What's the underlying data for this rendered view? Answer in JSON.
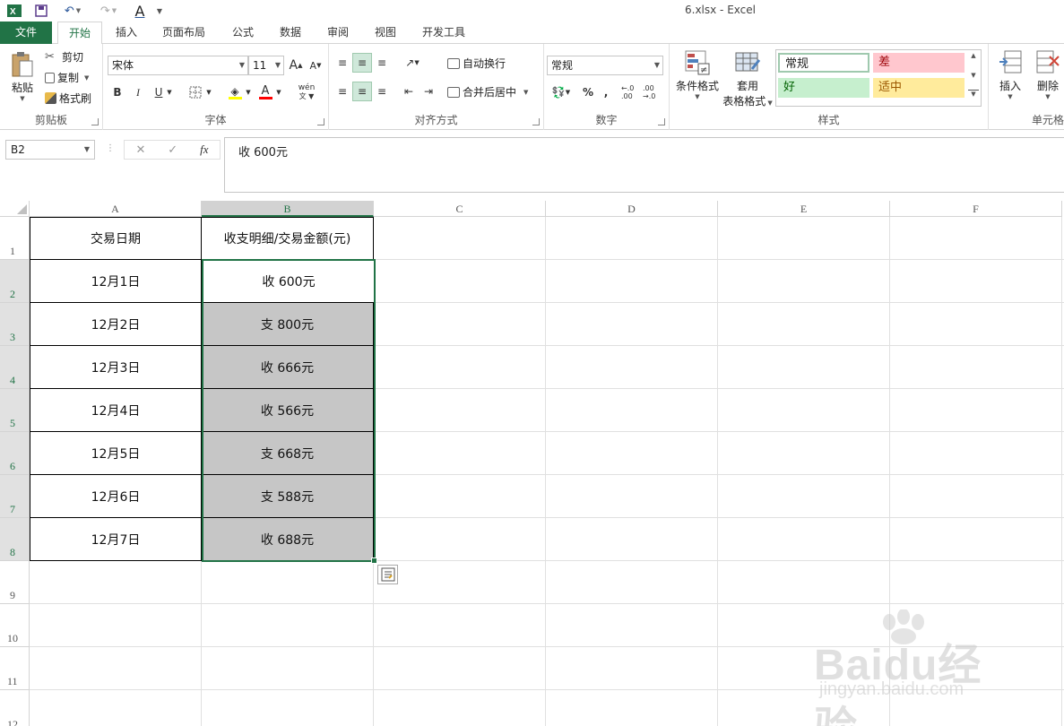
{
  "window": {
    "title": "6.xlsx - Excel"
  },
  "ribbon_tabs": [
    {
      "label": "文件"
    },
    {
      "label": "开始"
    },
    {
      "label": "插入"
    },
    {
      "label": "页面布局"
    },
    {
      "label": "公式"
    },
    {
      "label": "数据"
    },
    {
      "label": "审阅"
    },
    {
      "label": "视图"
    },
    {
      "label": "开发工具"
    }
  ],
  "clipboard": {
    "paste": "粘贴",
    "cut": "剪切",
    "copy": "复制",
    "format_painter": "格式刷",
    "group": "剪贴板"
  },
  "font": {
    "name": "宋体",
    "size": "11",
    "group": "字体",
    "bold": "B",
    "italic": "I",
    "underline": "U",
    "grow": "A",
    "shrink": "A",
    "phonetic": "wén",
    "font_color_letter": "A"
  },
  "alignment": {
    "wrap": "自动换行",
    "merge": "合并后居中",
    "group": "对齐方式"
  },
  "number": {
    "format": "常规",
    "group": "数字",
    "percent": "%",
    "comma": ",",
    "inc_dec": "←.0 .00",
    "dec_dec": ".00 →.0"
  },
  "styles": {
    "conditional": "条件格式",
    "table_1": "套用",
    "table_2": "表格格式",
    "group": "样式",
    "cells": [
      {
        "label": "常规",
        "bg": "#ffffff",
        "fg": "#000000"
      },
      {
        "label": "差",
        "bg": "#ffc7ce",
        "fg": "#9c0006"
      },
      {
        "label": "好",
        "bg": "#c6efce",
        "fg": "#006100"
      },
      {
        "label": "适中",
        "bg": "#ffeb9c",
        "fg": "#9c5700"
      }
    ]
  },
  "cells_group": {
    "insert": "插入",
    "delete": "删除",
    "group": "单元格"
  },
  "formula_bar": {
    "name_box": "B2",
    "fx": "fx",
    "content": "收 600元"
  },
  "sheet": {
    "columns": [
      "A",
      "B",
      "C",
      "D",
      "E",
      "F"
    ],
    "rows": [
      "1",
      "2",
      "3",
      "4",
      "5",
      "6",
      "7",
      "8",
      "9",
      "10",
      "11",
      "12"
    ],
    "header": [
      "交易日期",
      "收支明细/交易金额(元)"
    ],
    "data": [
      [
        "12月1日",
        "收 600元"
      ],
      [
        "12月2日",
        "支 800元"
      ],
      [
        "12月3日",
        "收 666元"
      ],
      [
        "12月4日",
        "收 566元"
      ],
      [
        "12月5日",
        "支 668元"
      ],
      [
        "12月6日",
        "支 588元"
      ],
      [
        "12月7日",
        "收 688元"
      ]
    ]
  },
  "colors": {
    "accent": "#217346",
    "selection_fill": "#c6c6c6"
  },
  "watermark": {
    "text": "Baidu经验",
    "url": "jingyan.baidu.com"
  }
}
